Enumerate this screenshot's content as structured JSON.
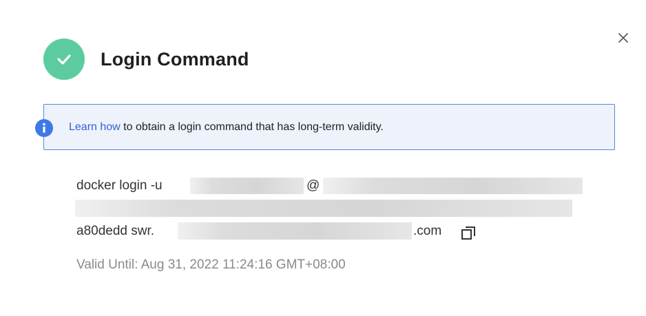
{
  "dialog": {
    "title": "Login Command",
    "close_icon": "close-icon",
    "status_icon": "check-circle-icon",
    "status_color": "#5ccca0"
  },
  "info": {
    "icon": "info-icon",
    "link_text": "Learn how",
    "text": " to obtain a login command that has long-term validity.",
    "link_color": "#2f64d1",
    "border_color": "#5c82d9"
  },
  "command": {
    "line1_prefix": "docker login -u ",
    "line1_at": "@",
    "line3_prefix": "a80dedd swr.",
    "line3_suffix": ".com",
    "copy_icon": "copy-icon"
  },
  "validity": {
    "text": "Valid Until: Aug 31, 2022 11:24:16 GMT+08:00"
  }
}
